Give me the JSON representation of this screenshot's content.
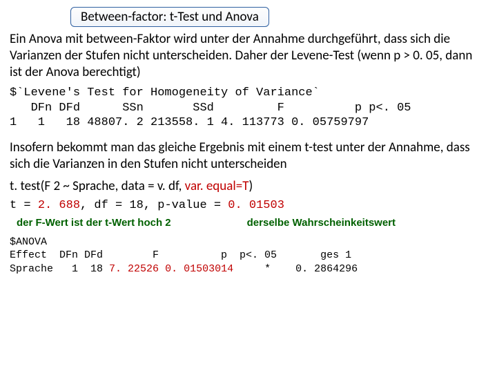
{
  "title": "Between-factor: t-Test und Anova",
  "para1": "Ein Anova mit between-Faktor wird unter der Annahme durchgeführt, dass sich die Varianzen der Stufen nicht unterscheiden. Daher der Levene-Test (wenn p > 0. 05, dann ist der Anova berechtigt)",
  "levene": {
    "title": "$`Levene's Test for Homogeneity of Variance`",
    "header": "   DFn DFd      SSn       SSd         F          p p<. 05",
    "row": "1   1   18 48807. 2 213558. 1 4. 113773 0. 05759797"
  },
  "para2": "Insofern bekommt man das gleiche Ergebnis mit einem t-test unter der Annahme, dass sich die Varianzen in den Stufen nicht unterscheiden",
  "ttest_call_pre": "t. test(F 2 ~ Sprache, data = v. df, ",
  "ttest_call_var": "var. equal=T",
  "ttest_call_post": ")",
  "ttest_result_pre": "t = ",
  "ttest_result_t": "2. 688",
  "ttest_result_mid": ", df = 18, p-value = ",
  "ttest_result_p": "0. 01503",
  "note_left": "der F-Wert ist der t-Wert hoch 2",
  "note_right": "derselbe Wahrscheinkeitswert",
  "anova": {
    "l1": "$ANOVA",
    "l2": "Effect  DFn DFd        F          p  p<. 05       ges 1",
    "l3_pre": "Sprache   1  18 ",
    "l3_F": "7. 22526",
    "l3_mid": " ",
    "l3_p": "0. 01503014",
    "l3_post": "     *    0. 2864296"
  }
}
